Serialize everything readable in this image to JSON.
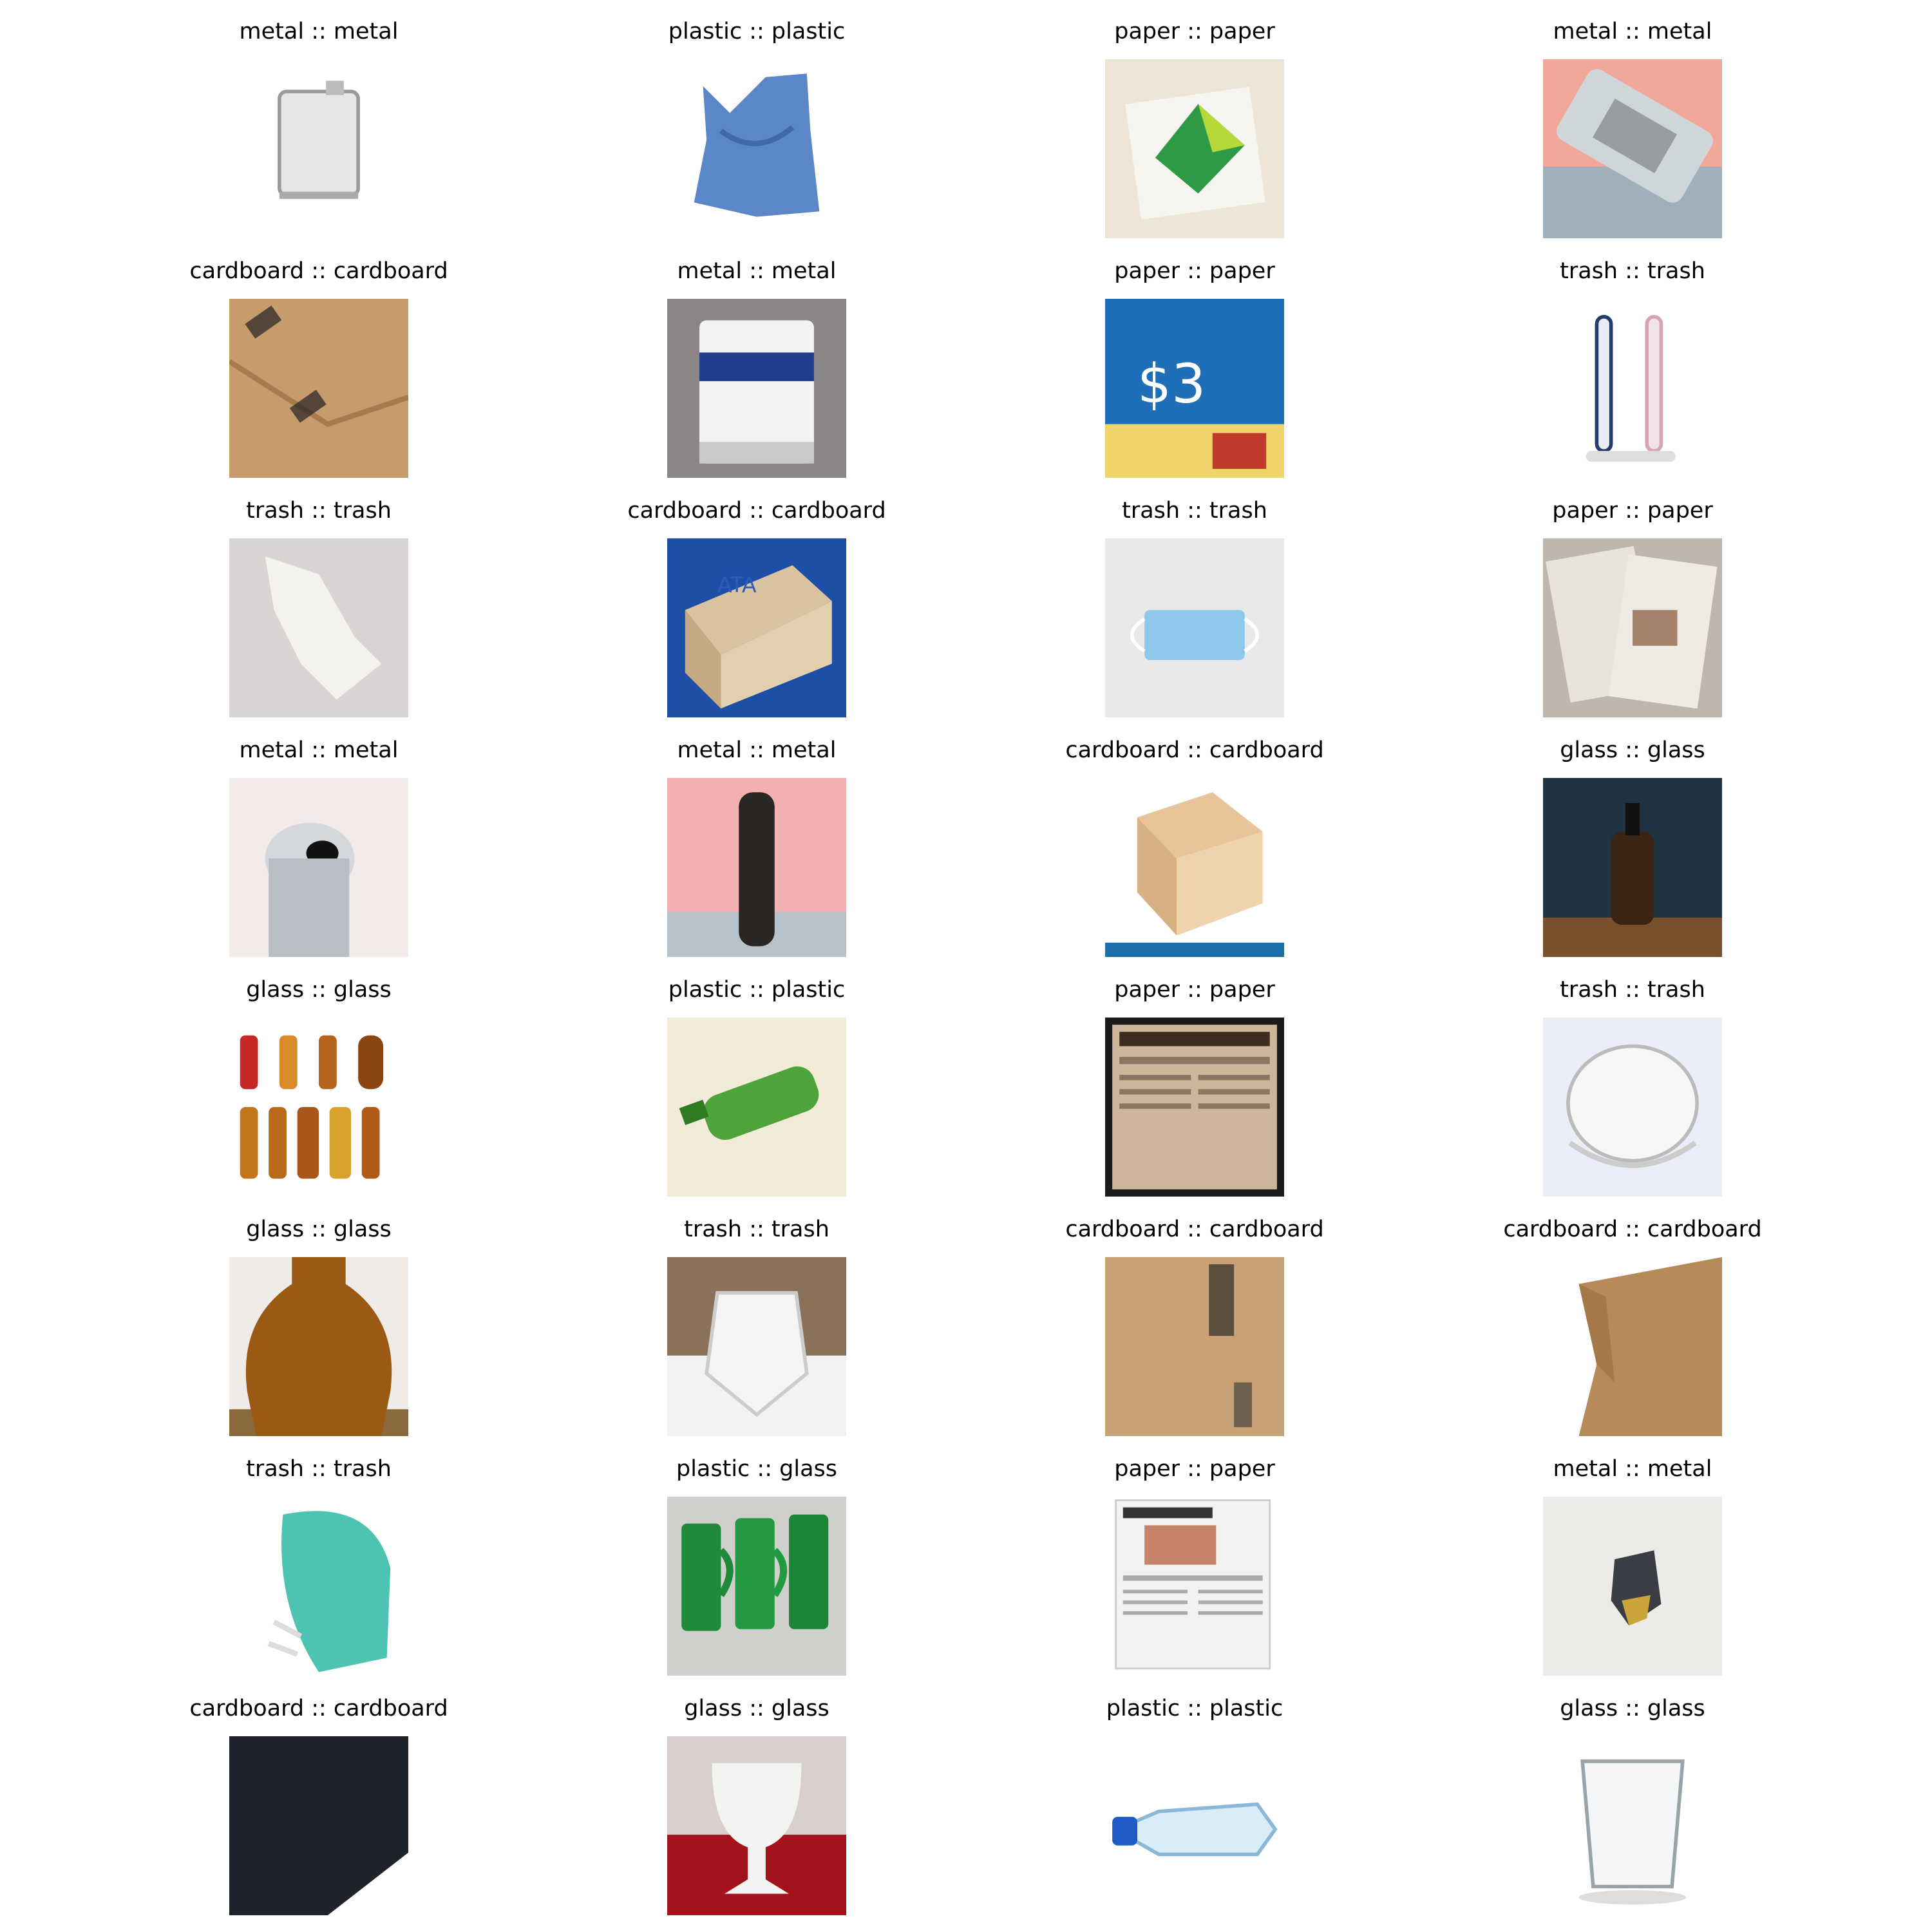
{
  "cells": [
    {
      "label": "metal :: metal",
      "icon": "metal-can-icon"
    },
    {
      "label": "plastic :: plastic",
      "icon": "plastic-bag-icon"
    },
    {
      "label": "paper :: paper",
      "icon": "paper-envelope-icon"
    },
    {
      "label": "metal :: metal",
      "icon": "metal-can-icon"
    },
    {
      "label": "cardboard :: cardboard",
      "icon": "cardboard-box-icon"
    },
    {
      "label": "metal :: metal",
      "icon": "paint-tin-icon"
    },
    {
      "label": "paper :: paper",
      "icon": "paper-flyer-icon"
    },
    {
      "label": "trash :: trash",
      "icon": "toothbrush-icon"
    },
    {
      "label": "trash :: trash",
      "icon": "crumpled-wrapper-icon"
    },
    {
      "label": "cardboard :: cardboard",
      "icon": "cardboard-box-icon"
    },
    {
      "label": "trash :: trash",
      "icon": "face-mask-icon"
    },
    {
      "label": "paper :: paper",
      "icon": "newspaper-icon"
    },
    {
      "label": "metal :: metal",
      "icon": "metal-can-icon"
    },
    {
      "label": "metal :: metal",
      "icon": "aerosol-can-icon"
    },
    {
      "label": "cardboard :: cardboard",
      "icon": "cardboard-box-icon"
    },
    {
      "label": "glass :: glass",
      "icon": "glass-bottle-icon"
    },
    {
      "label": "glass :: glass",
      "icon": "glass-bottles-icon"
    },
    {
      "label": "plastic :: plastic",
      "icon": "plastic-bottle-icon"
    },
    {
      "label": "paper :: paper",
      "icon": "newspaper-icon"
    },
    {
      "label": "trash :: trash",
      "icon": "face-mask-icon"
    },
    {
      "label": "glass :: glass",
      "icon": "glass-jug-icon"
    },
    {
      "label": "trash :: trash",
      "icon": "face-mask-icon"
    },
    {
      "label": "cardboard :: cardboard",
      "icon": "cardboard-box-icon"
    },
    {
      "label": "cardboard :: cardboard",
      "icon": "cardboard-sheet-icon"
    },
    {
      "label": "trash :: trash",
      "icon": "face-mask-icon"
    },
    {
      "label": "plastic :: glass",
      "icon": "glass-mugs-icon"
    },
    {
      "label": "paper :: paper",
      "icon": "newspaper-icon"
    },
    {
      "label": "metal :: metal",
      "icon": "crushed-can-icon"
    },
    {
      "label": "cardboard :: cardboard",
      "icon": "cardboard-sheet-icon"
    },
    {
      "label": "glass :: glass",
      "icon": "glass-goblet-icon"
    },
    {
      "label": "plastic :: plastic",
      "icon": "plastic-bottle-icon"
    },
    {
      "label": "glass :: glass",
      "icon": "drinking-glass-icon"
    }
  ]
}
